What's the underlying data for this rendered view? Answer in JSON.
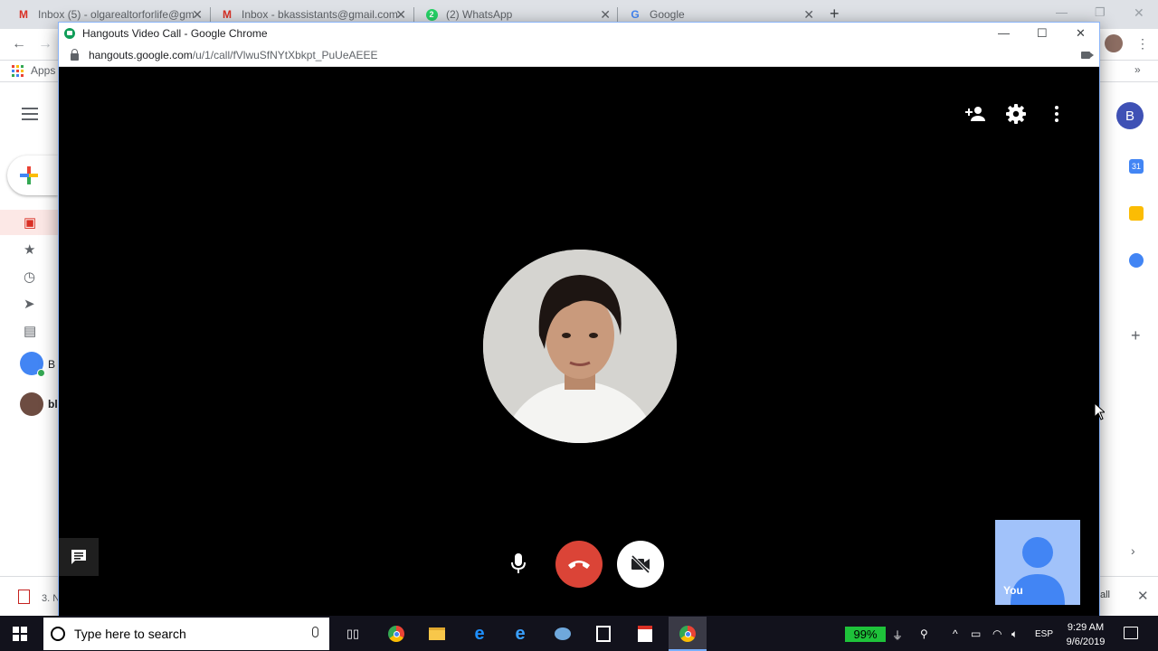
{
  "browser": {
    "tabs": [
      {
        "label": "Inbox (5) - olgarealtorforlife@gm",
        "favicon": "gmail-icon"
      },
      {
        "label": "Inbox - bkassistants@gmail.com",
        "favicon": "gmail-icon"
      },
      {
        "label": "(2) WhatsApp",
        "favicon": "whatsapp-icon",
        "badge": "2"
      },
      {
        "label": "Google",
        "favicon": "google-icon"
      }
    ],
    "bookmarks_apps_label": "Apps",
    "overflow_label": "»"
  },
  "gmail": {
    "sidebar_labels": [
      "B",
      "bl"
    ],
    "account_initial": "B",
    "calendar_badge": "31"
  },
  "download_bar": {
    "item_label": "3. N",
    "show_all_label": "all"
  },
  "popup": {
    "title": "Hangouts Video Call - Google Chrome",
    "url_host": "hangouts.google.com",
    "url_path": "/u/1/call/fVlwuSfNYtXbkpt_PuUeAEEE"
  },
  "call": {
    "self_label": "You",
    "colors": {
      "end_call": "#db4437",
      "self_tile": "#a1c2fa",
      "background": "#000000"
    }
  },
  "taskbar": {
    "search_placeholder": "Type here to search",
    "battery": "99%",
    "language": "ESP",
    "time": "9:29 AM",
    "date": "9/6/2019"
  }
}
